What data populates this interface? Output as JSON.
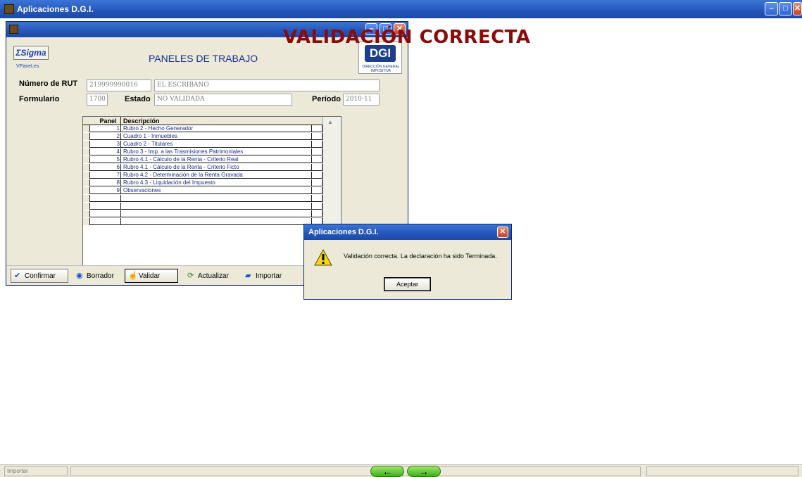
{
  "app": {
    "title": "Aplicaciones  D.G.I."
  },
  "overlay": {
    "text": "VALIDACIÓN CORRECTA",
    "color": "#8b0a0a"
  },
  "window_controls": {
    "minimize": "–",
    "maximize": "□",
    "close": "✕"
  },
  "header": {
    "sigma_logo": "ΣSigma",
    "sigma_sub": "VPaneLes",
    "title": "PANELES DE TRABAJO",
    "dgi_logo": "DGI",
    "dgi_caption": "DIRECCIÓN GENERAL IMPOSITIVA"
  },
  "form": {
    "rut_label": "Número de RUT",
    "rut_value": "219999990016",
    "name_value": "EL ESCRIBANO",
    "formulario_label": "Formulario",
    "formulario_value": "1700",
    "estado_label": "Estado",
    "estado_value": "NO VALIDADA",
    "periodo_label": "Período",
    "periodo_value": "2010-11"
  },
  "grid": {
    "header_panel": "Panel",
    "header_desc": "Descripción",
    "rows": [
      {
        "panel": "1",
        "desc": "Rubro 2 - Hecho Generador"
      },
      {
        "panel": "2",
        "desc": "Cuadro 1 - Inmuebles"
      },
      {
        "panel": "3",
        "desc": "Cuadro 2 - Titulares"
      },
      {
        "panel": "4",
        "desc": "Rubro 3 - Imp. a las Trasmisiones Patrimoniales"
      },
      {
        "panel": "5",
        "desc": "Rubro 4.1 -  Cálculo de la Renta - Criterio Real"
      },
      {
        "panel": "6",
        "desc": "Rubro 4.1 -  Cálculo de la Renta - Criterio Ficto"
      },
      {
        "panel": "7",
        "desc": "Rubro 4.2 -  Determinación de la Renta Gravada"
      },
      {
        "panel": "8",
        "desc": "Rubro 4.3 - Liquidación del Impuesto"
      },
      {
        "panel": "9",
        "desc": "Observaciones"
      },
      {
        "panel": "",
        "desc": ""
      },
      {
        "panel": "",
        "desc": ""
      },
      {
        "panel": "",
        "desc": ""
      },
      {
        "panel": "",
        "desc": ""
      }
    ]
  },
  "toolbar": {
    "confirmar": "Confirmar",
    "borrador": "Borrador",
    "validar": "Validar",
    "actualizar": "Actualizar",
    "importar": "Importar"
  },
  "dialog": {
    "title": "Aplicaciones  D.G.I.",
    "message": "Validación correcta. La declaración ha sido Terminada.",
    "ok": "Aceptar"
  },
  "statusbar": {
    "left": "Importar"
  },
  "nav": {
    "back": "←",
    "forward": "→"
  }
}
